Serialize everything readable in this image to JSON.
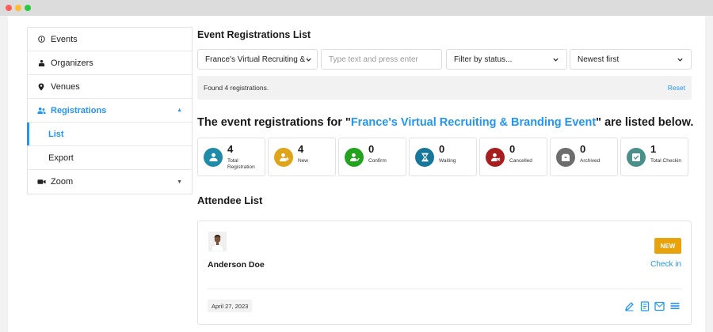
{
  "sidebar": {
    "items": [
      {
        "label": "Events"
      },
      {
        "label": "Organizers"
      },
      {
        "label": "Venues"
      },
      {
        "label": "Registrations"
      },
      {
        "label": "Zoom"
      }
    ],
    "submenu": [
      {
        "label": "List"
      },
      {
        "label": "Export"
      }
    ]
  },
  "main": {
    "title": "Event Registrations List",
    "filters": {
      "event_select": "France's Virtual Recruiting & B",
      "search_placeholder": "Type text and press enter",
      "status_select": "Filter by status...",
      "sort_select": "Newest first"
    },
    "found_text": "Found 4 registrations.",
    "reset_label": "Reset",
    "headline": {
      "prefix": "The event registrations for \"",
      "event": "France's Virtual Recruiting & Branding Event",
      "suffix": "\" are listed below."
    },
    "stats": [
      {
        "value": "4",
        "label": "Total Registration",
        "color": "#1e8ba8"
      },
      {
        "value": "4",
        "label": "New",
        "color": "#e0a419"
      },
      {
        "value": "0",
        "label": "Confirm",
        "color": "#22a31d"
      },
      {
        "value": "0",
        "label": "Waiting",
        "color": "#16779b"
      },
      {
        "value": "0",
        "label": "Cancelled",
        "color": "#a81d1d"
      },
      {
        "value": "0",
        "label": "Archived",
        "color": "#6d6d6d"
      },
      {
        "value": "1",
        "label": "Total Checkin",
        "color": "#4b8f8a"
      }
    ],
    "attendee_title": "Attendee List",
    "attendee": {
      "name": "Anderson Doe",
      "badge": "NEW",
      "checkin_label": "Check in",
      "date": "April 27, 2023"
    }
  },
  "colors": {
    "accent": "#2196f3",
    "badge_new": "#e8a20c"
  }
}
